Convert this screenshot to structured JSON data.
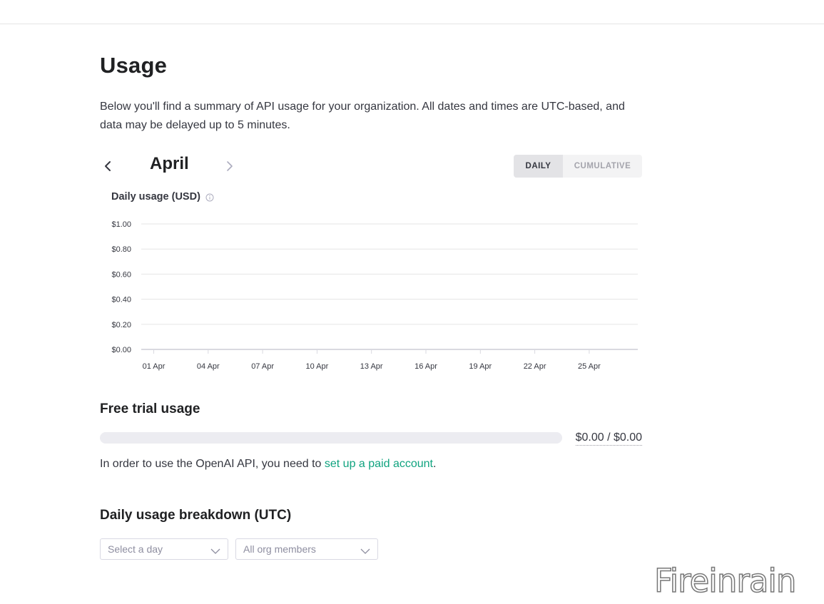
{
  "page": {
    "title": "Usage",
    "intro": "Below you'll find a summary of API usage for your organization. All dates and times are UTC-based, and data may be delayed up to 5 minutes."
  },
  "month_nav": {
    "month": "April",
    "prev_icon": "chevron-left-icon",
    "next_icon": "chevron-right-icon",
    "modes": [
      "DAILY",
      "CUMULATIVE"
    ],
    "selected_mode": "DAILY"
  },
  "chart_data": {
    "type": "bar",
    "title": "Daily usage (USD)",
    "xlabel": "",
    "ylabel": "",
    "categories": [
      "01 Apr",
      "04 Apr",
      "07 Apr",
      "10 Apr",
      "13 Apr",
      "16 Apr",
      "19 Apr",
      "22 Apr",
      "25 Apr"
    ],
    "values": [
      0,
      0,
      0,
      0,
      0,
      0,
      0,
      0,
      0
    ],
    "y_ticks": [
      "$0.00",
      "$0.20",
      "$0.40",
      "$0.60",
      "$0.80",
      "$1.00"
    ],
    "ylim": [
      0,
      1
    ],
    "grid": true,
    "info_icon": "info-icon"
  },
  "free_trial": {
    "heading": "Free trial usage",
    "used": 0,
    "amount_text": "$0.00 / $0.00",
    "notice_prefix": "In order to use the OpenAI API, you need to ",
    "notice_link": "set up a paid account",
    "notice_suffix": "."
  },
  "breakdown": {
    "heading": "Daily usage breakdown (UTC)",
    "day_select_placeholder": "Select a day",
    "members_select_value": "All org members"
  },
  "colors": {
    "accent": "#10a37f",
    "track": "#ececf1",
    "grid": "#e5e5e5"
  },
  "watermark": "Fireinrain"
}
